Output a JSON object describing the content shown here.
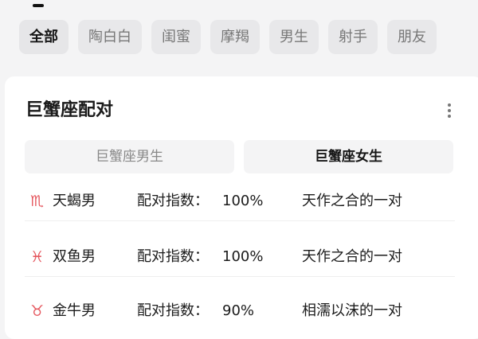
{
  "tabs": [
    {
      "label": "全部",
      "active": true
    },
    {
      "label": "陶白白",
      "active": false
    },
    {
      "label": "闺蜜",
      "active": false
    },
    {
      "label": "摩羯",
      "active": false
    },
    {
      "label": "男生",
      "active": false
    },
    {
      "label": "射手",
      "active": false
    },
    {
      "label": "朋友",
      "active": false
    }
  ],
  "card": {
    "title": "巨蟹座配对",
    "more_icon": "more-vertical-icon",
    "segments": {
      "male": "巨蟹座男生",
      "female": "巨蟹座女生",
      "selected": "female"
    },
    "rows": [
      {
        "sign_icon": "scorpio-symbol",
        "sign": "♏",
        "name": "天蝎男",
        "index_label": "配对指数：",
        "index_value": "100%",
        "desc": "天作之合的一对"
      },
      {
        "sign_icon": "pisces-symbol",
        "sign": "♓",
        "name": "双鱼男",
        "index_label": "配对指数：",
        "index_value": "100%",
        "desc": "天作之合的一对"
      },
      {
        "sign_icon": "taurus-symbol",
        "sign": "♉",
        "name": "金牛男",
        "index_label": "配对指数：",
        "index_value": "90%",
        "desc": "相濡以沫的一对"
      }
    ]
  },
  "colors": {
    "background": "#f4f4f5",
    "chip_bg": "#e8e8ea",
    "card_bg": "#ffffff",
    "sign_red": "#e5585f"
  }
}
